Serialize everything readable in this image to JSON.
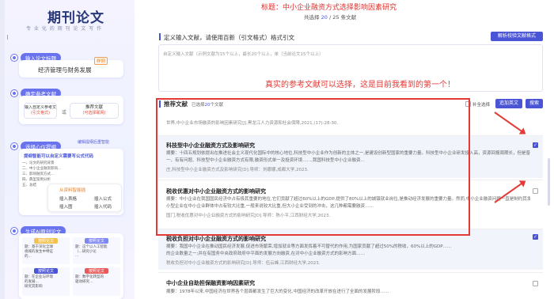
{
  "header": {
    "title_prefix": "标题：",
    "title": "中小企业融资方式选择影响因素研究",
    "count_label": "共选择",
    "count_value": "20",
    "count_sep": "/",
    "count_total": "25",
    "count_unit": "条文献"
  },
  "sidebar": {
    "logo": "期刊论文",
    "slogan": "专 业 化 的 期 刊 论 文 写 作",
    "step1": {
      "label": "输入论文标题",
      "tag": "样例",
      "value": "经济管理与财务发展"
    },
    "step2": {
      "label": "确定参考文献",
      "left": "输入自定义参考文献",
      "left_sub": "(引文格式)",
      "or": "或",
      "right": "推荐文献",
      "right_sub": "(可选择联网)"
    },
    "step3": {
      "label": "选择心仪提纲",
      "tag": "编辑提纲后重智能",
      "item1": "提纲智能可以自定义需要写公式代码",
      "rows": [
        "一、论文的研究背景",
        "二、中小企业融资影响...",
        "三、影响融资方式...",
        "四、典型案例分析",
        "五、总结"
      ],
      "panel_title": "从资料智能插",
      "opts": [
        "插入表格",
        "插入公式",
        "插入图",
        "插入代码"
      ]
    },
    "step4": {
      "label": "生成AI原创论文",
      "b1": "按照论文",
      "b1a": "题：基于深化全球",
      "b1b": "视域的发生中特征",
      "b1c": "的...",
      "b2": "按照论文",
      "b2a": "题：这个以人工智能",
      "b2b": "（...研究小论",
      "b2c": "...",
      "b3": "按照论文",
      "b3a": "题：在企业与环境",
      "b3b": "的发展...",
      "b3c": "研究其影响",
      "b4": "按照论文",
      "b4a": "题：数字化转型的",
      "b4b": "驱动研究..."
    }
  },
  "custom": {
    "label": "定义输入文献，请使用百新（引文格式）格式引文",
    "btn": "解析校验文献格式",
    "placeholder1": "自定义输入文献（示例文献为15个以上，最长20个以上，单（当前论文15个以上）",
    "overlay": "真实的参考文献可以选择，这是目前我看到的第一个！"
  },
  "rec": {
    "label": "推荐文献",
    "selected_prefix": "已选择",
    "selected_count": "20",
    "selected_suffix": "个文献",
    "check_label": "补全选择",
    "btn1": "追加英文",
    "btn2": "搜索"
  },
  "refs": [
    {
      "source": "世界,中小企业市场融资的影响因素研究[J].黑龙江人力资源和社会保障,2021,(17):28-30.",
      "checked": false
    },
    {
      "title": "科技型中小企业融资方式及影响研究",
      "abs": "摘要：十四五规划依提出在推进社会主义现代化国际中的核心地位,科技型中小企业作为创新的主体之一,是建设创新型国家的重要力量。科技型中小企业研发投入高，资源回报周期长，但是普遍融资难、融资贵。科技型中小企业融资问题严峻……",
      "abs2": "一、有有问题、科技型中小企业融资方式有限,融资形式单一及投资环境……,我国科技型中小企业融资...",
      "source": "庄,科技型中小企业融资方式及影响研究[D].导师：刘娜娜,成都大学,2023.",
      "checked": true
    },
    {
      "title": "税收优惠对中小企业融资方式的影响研究",
      "abs": "摘要：中小企业在我国国民经济中占有极其重要的地位,它们贡献了超过60%以上的GDP,提供了80%以上的城镇就业岗位,是推动经济发展的重要力量。然而,中小企业融资问题一直是制约其发展的关键因素……",
      "abs2": "小型企业在中小企业群体中占有较大比重,一般来说较大比重,但大小企业受到的冲击，这几种都需要融资……",
      "source": "国门,税收优惠对中小企业融资方式的影响研究[D].导师：陈小平,江西财经大学,2023.",
      "checked": false
    },
    {
      "title": "税收负担对中小企业融资方式的影响研究",
      "abs": "摘要：我国中小企业在推动国民经济发展,促进市场繁荣,增加就业等方面发挥着不可替代的作用,为国家贡献了超过50%的税收，60%以上的GDP……",
      "abs2": "的企业数量之一;并在有国务中央政府政府中平面的发展方向融资,在对中小企业融资方式的影响方面……",
      "source": "税收负担对中小企业融资方式的影响研究[D].导师：伍云峰,江西财经大学,2023.",
      "checked": true
    },
    {
      "title": "中小企业自助担保融资影响因素研究",
      "abs": "摘要：1978年以来,中国经济在世界各个层面都发生了巨大的变化,中国经济的改革开放在进行了全面的发展阶段……",
      "abs2": "",
      "source": "",
      "checked": false
    }
  ]
}
